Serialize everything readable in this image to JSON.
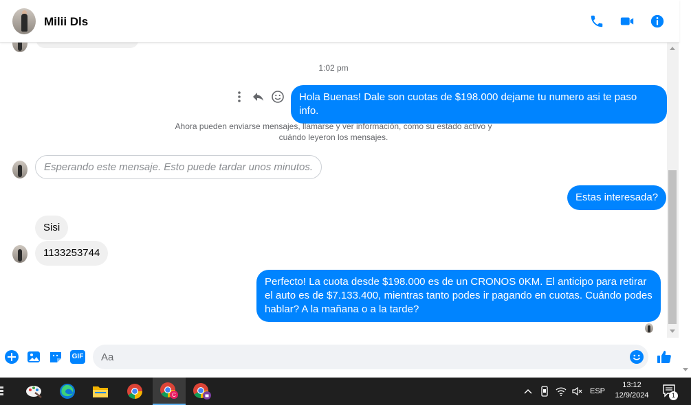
{
  "header": {
    "contact_name": "Milii Dls"
  },
  "chat": {
    "timestamp": "1:02 pm",
    "messages": [
      {
        "text": "Hola Buenas! Dale son cuotas de $198.000 dejame tu numero asi te paso info."
      },
      {
        "text": "Estas interesada?"
      },
      {
        "text": "Sisi"
      },
      {
        "text": "1133253744"
      },
      {
        "text": "Perfecto! La cuota desde $198.000 es de un CRONOS 0KM. El anticipo para retirar el auto es de $7.133.400, mientras tanto podes ir pagando en cuotas. Cuándo podes hablar? A la mañana o a la tarde?"
      }
    ],
    "system_note": "Ahora pueden enviarse mensajes, llamarse y ver información, como su estado activo y cuándo leyeron los mensajes.",
    "pending_message": "Esperando este mensaje. Esto puede tardar unos minutos."
  },
  "composer": {
    "placeholder": "Aa",
    "gif_label": "GIF"
  },
  "taskbar": {
    "language": "ESP",
    "time": "13:12",
    "date": "12/9/2024",
    "notification_count": "1"
  },
  "colors": {
    "messenger_blue": "#0084ff",
    "incoming_bubble": "#f0f0f0",
    "taskbar": "#1f1f1f"
  },
  "icons": [
    "phone-icon",
    "video-icon",
    "info-icon",
    "more-icon",
    "reply-icon",
    "emoji-icon",
    "plus-icon",
    "image-icon",
    "sticker-icon",
    "gif-icon",
    "like-icon"
  ]
}
